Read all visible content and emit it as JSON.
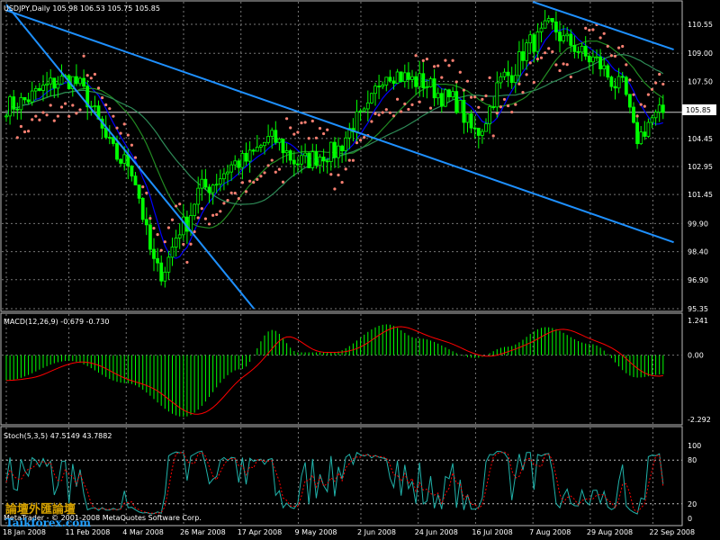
{
  "chart_data": [
    {
      "type": "candlestick",
      "title": "USDJPY,Daily  105.98 106.53 105.75 105.85",
      "current_price": 105.85,
      "current_price_label": "105.85",
      "ylim": [
        95.35,
        111.75
      ],
      "y_ticks": [
        "110.55",
        "109.00",
        "107.50",
        "105.85",
        "104.45",
        "102.95",
        "101.45",
        "99.90",
        "98.40",
        "96.90",
        "95.35"
      ],
      "x_ticks": [
        "18 Jan 2008",
        "11 Feb 2008",
        "4 Mar 2008",
        "26 Mar 2008",
        "17 Apr 2008",
        "9 May 2008",
        "2 Jun 2008",
        "24 Jun 2008",
        "16 Jul 2008",
        "7 Aug 2008",
        "29 Aug 2008",
        "22 Sep 2008"
      ],
      "close_anchors": [
        {
          "x": "18 Jan 2008",
          "y": 106.2
        },
        {
          "x": "11 Feb 2008",
          "y": 107.6
        },
        {
          "x": "4 Mar 2008",
          "y": 103.2
        },
        {
          "x": "17 Mar 2008",
          "y": 97.3
        },
        {
          "x": "26 Mar 2008",
          "y": 99.8
        },
        {
          "x": "2 Apr 2008",
          "y": 101.8
        },
        {
          "x": "17 Apr 2008",
          "y": 103.2
        },
        {
          "x": "29 Apr 2008",
          "y": 104.4
        },
        {
          "x": "9 May 2008",
          "y": 103.2
        },
        {
          "x": "22 May 2008",
          "y": 103.7
        },
        {
          "x": "2 Jun 2008",
          "y": 105.5
        },
        {
          "x": "12 Jun 2008",
          "y": 108.0
        },
        {
          "x": "24 Jun 2008",
          "y": 107.5
        },
        {
          "x": "7 Jul 2008",
          "y": 106.5
        },
        {
          "x": "16 Jul 2008",
          "y": 104.8
        },
        {
          "x": "28 Jul 2008",
          "y": 107.8
        },
        {
          "x": "7 Aug 2008",
          "y": 109.6
        },
        {
          "x": "14 Aug 2008",
          "y": 110.4
        },
        {
          "x": "20 Aug 2008",
          "y": 109.6
        },
        {
          "x": "29 Aug 2008",
          "y": 108.7
        },
        {
          "x": "10 Sep 2008",
          "y": 107.2
        },
        {
          "x": "16 Sep 2008",
          "y": 104.5
        },
        {
          "x": "22 Sep 2008",
          "y": 105.5
        },
        {
          "x": "26 Sep 2008",
          "y": 105.85
        }
      ],
      "trendlines": [
        {
          "from": {
            "x": "18 Jan 2008",
            "y": 111.6
          },
          "to": {
            "x": "22 Apr 2008",
            "y": 95.35
          }
        },
        {
          "from": {
            "x": "18 Jan 2008",
            "y": 111.3
          },
          "to": {
            "x": "30 Sep 2008",
            "y": 98.9
          }
        },
        {
          "from": {
            "x": "7 Aug 2008",
            "y": 111.75
          },
          "to": {
            "x": "30 Sep 2008",
            "y": 109.2
          }
        }
      ],
      "colors": {
        "candle_up": "#00ff00",
        "candle_down": "#00ff00",
        "sar": "#fa8072",
        "trendline": "#1e90ff",
        "ma_fast": "#0000ff",
        "ma_medium": "#228b22",
        "ma_slow": "#2e8b57",
        "grid": "#777777"
      }
    },
    {
      "type": "bar",
      "title": "MACD(12,26,9) -0.679 -0.730",
      "ylim": [
        -2.292,
        1.241
      ],
      "y_ticks": [
        "1.241",
        "0.00",
        "-2.292"
      ],
      "macd_anchors": [
        {
          "x": "18 Jan 2008",
          "y": -0.9
        },
        {
          "x": "11 Feb 2008",
          "y": -0.2
        },
        {
          "x": "4 Mar 2008",
          "y": -1.0
        },
        {
          "x": "26 Mar 2008",
          "y": -2.2
        },
        {
          "x": "17 Apr 2008",
          "y": -0.5
        },
        {
          "x": "29 Apr 2008",
          "y": 0.9
        },
        {
          "x": "9 May 2008",
          "y": 0.1
        },
        {
          "x": "22 May 2008",
          "y": 0.1
        },
        {
          "x": "12 Jun 2008",
          "y": 1.1
        },
        {
          "x": "24 Jun 2008",
          "y": 0.6
        },
        {
          "x": "16 Jul 2008",
          "y": -0.1
        },
        {
          "x": "28 Jul 2008",
          "y": 0.3
        },
        {
          "x": "12 Aug 2008",
          "y": 1.0
        },
        {
          "x": "29 Aug 2008",
          "y": 0.4
        },
        {
          "x": "16 Sep 2008",
          "y": -0.8
        },
        {
          "x": "26 Sep 2008",
          "y": -0.679
        }
      ],
      "signal_last": -0.73,
      "colors": {
        "histogram": "#00ff00",
        "signal": "#ff0000"
      }
    },
    {
      "type": "line",
      "title": "Stoch(5,3,5) 47.5149 43.7882",
      "ylim": [
        0,
        100
      ],
      "y_ticks": [
        "100",
        "80",
        "20",
        "0"
      ],
      "main_last": 47.5149,
      "signal_last": 43.7882,
      "colors": {
        "main": "#20b2aa",
        "signal": "#ff0000",
        "levels": "#c0c0c0"
      }
    }
  ],
  "footer": {
    "text": "MetaTrader - © 2001-2008 MetaQuotes Software Corp."
  },
  "watermark": {
    "line1": "論壇外匯論壇",
    "line2": "Taikforex.com"
  }
}
